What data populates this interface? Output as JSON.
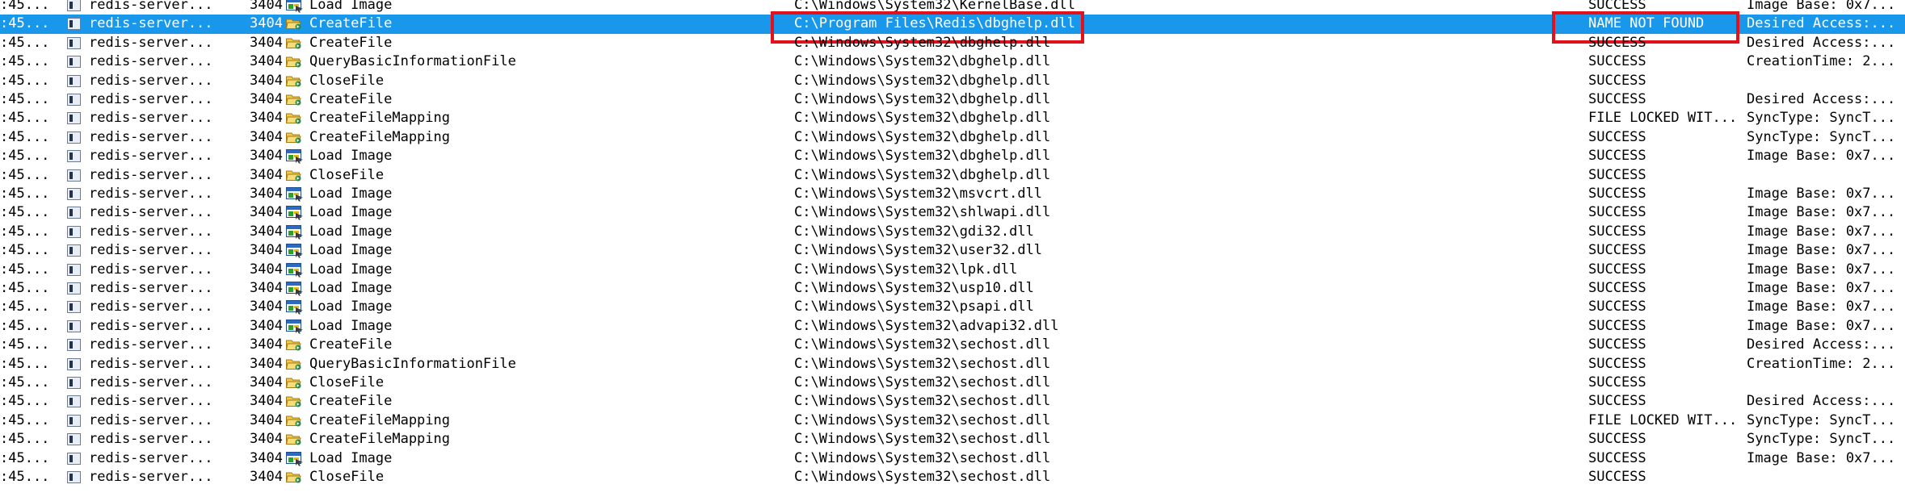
{
  "colors": {
    "selection": "#1997ea",
    "annotation": "#e3111b"
  },
  "rows": [
    {
      "time": ":45...",
      "process": "redis-server...",
      "pid": "3404",
      "op_icon": "load-image-icon",
      "operation": "Load Image",
      "path": "C:\\Windows\\System32\\KernelBase.dll",
      "result": "SUCCESS",
      "detail": "Image Base: 0x7..."
    },
    {
      "time": ":45...",
      "process": "redis-server...",
      "pid": "3404",
      "op_icon": "file-system-icon",
      "operation": "CreateFile",
      "path": "C:\\Program Files\\Redis\\dbghelp.dll",
      "result": "NAME NOT FOUND",
      "detail": "Desired Access:...",
      "selected": true
    },
    {
      "time": ":45...",
      "process": "redis-server...",
      "pid": "3404",
      "op_icon": "file-system-icon",
      "operation": "CreateFile",
      "path": "C:\\Windows\\System32\\dbghelp.dll",
      "result": "SUCCESS",
      "detail": "Desired Access:..."
    },
    {
      "time": ":45...",
      "process": "redis-server...",
      "pid": "3404",
      "op_icon": "file-system-icon",
      "operation": "QueryBasicInformationFile",
      "path": "C:\\Windows\\System32\\dbghelp.dll",
      "result": "SUCCESS",
      "detail": "CreationTime: 2..."
    },
    {
      "time": ":45...",
      "process": "redis-server...",
      "pid": "3404",
      "op_icon": "file-system-icon",
      "operation": "CloseFile",
      "path": "C:\\Windows\\System32\\dbghelp.dll",
      "result": "SUCCESS",
      "detail": ""
    },
    {
      "time": ":45...",
      "process": "redis-server...",
      "pid": "3404",
      "op_icon": "file-system-icon",
      "operation": "CreateFile",
      "path": "C:\\Windows\\System32\\dbghelp.dll",
      "result": "SUCCESS",
      "detail": "Desired Access:..."
    },
    {
      "time": ":45...",
      "process": "redis-server...",
      "pid": "3404",
      "op_icon": "file-system-icon",
      "operation": "CreateFileMapping",
      "path": "C:\\Windows\\System32\\dbghelp.dll",
      "result": "FILE LOCKED WIT...",
      "detail": "SyncType: SyncT..."
    },
    {
      "time": ":45...",
      "process": "redis-server...",
      "pid": "3404",
      "op_icon": "file-system-icon",
      "operation": "CreateFileMapping",
      "path": "C:\\Windows\\System32\\dbghelp.dll",
      "result": "SUCCESS",
      "detail": "SyncType: SyncT..."
    },
    {
      "time": ":45...",
      "process": "redis-server...",
      "pid": "3404",
      "op_icon": "load-image-icon",
      "operation": "Load Image",
      "path": "C:\\Windows\\System32\\dbghelp.dll",
      "result": "SUCCESS",
      "detail": "Image Base: 0x7..."
    },
    {
      "time": ":45...",
      "process": "redis-server...",
      "pid": "3404",
      "op_icon": "file-system-icon",
      "operation": "CloseFile",
      "path": "C:\\Windows\\System32\\dbghelp.dll",
      "result": "SUCCESS",
      "detail": ""
    },
    {
      "time": ":45...",
      "process": "redis-server...",
      "pid": "3404",
      "op_icon": "load-image-icon",
      "operation": "Load Image",
      "path": "C:\\Windows\\System32\\msvcrt.dll",
      "result": "SUCCESS",
      "detail": "Image Base: 0x7..."
    },
    {
      "time": ":45...",
      "process": "redis-server...",
      "pid": "3404",
      "op_icon": "load-image-icon",
      "operation": "Load Image",
      "path": "C:\\Windows\\System32\\shlwapi.dll",
      "result": "SUCCESS",
      "detail": "Image Base: 0x7..."
    },
    {
      "time": ":45...",
      "process": "redis-server...",
      "pid": "3404",
      "op_icon": "load-image-icon",
      "operation": "Load Image",
      "path": "C:\\Windows\\System32\\gdi32.dll",
      "result": "SUCCESS",
      "detail": "Image Base: 0x7..."
    },
    {
      "time": ":45...",
      "process": "redis-server...",
      "pid": "3404",
      "op_icon": "load-image-icon",
      "operation": "Load Image",
      "path": "C:\\Windows\\System32\\user32.dll",
      "result": "SUCCESS",
      "detail": "Image Base: 0x7..."
    },
    {
      "time": ":45...",
      "process": "redis-server...",
      "pid": "3404",
      "op_icon": "load-image-icon",
      "operation": "Load Image",
      "path": "C:\\Windows\\System32\\lpk.dll",
      "result": "SUCCESS",
      "detail": "Image Base: 0x7..."
    },
    {
      "time": ":45...",
      "process": "redis-server...",
      "pid": "3404",
      "op_icon": "load-image-icon",
      "operation": "Load Image",
      "path": "C:\\Windows\\System32\\usp10.dll",
      "result": "SUCCESS",
      "detail": "Image Base: 0x7..."
    },
    {
      "time": ":45...",
      "process": "redis-server...",
      "pid": "3404",
      "op_icon": "load-image-icon",
      "operation": "Load Image",
      "path": "C:\\Windows\\System32\\psapi.dll",
      "result": "SUCCESS",
      "detail": "Image Base: 0x7..."
    },
    {
      "time": ":45...",
      "process": "redis-server...",
      "pid": "3404",
      "op_icon": "load-image-icon",
      "operation": "Load Image",
      "path": "C:\\Windows\\System32\\advapi32.dll",
      "result": "SUCCESS",
      "detail": "Image Base: 0x7..."
    },
    {
      "time": ":45...",
      "process": "redis-server...",
      "pid": "3404",
      "op_icon": "file-system-icon",
      "operation": "CreateFile",
      "path": "C:\\Windows\\System32\\sechost.dll",
      "result": "SUCCESS",
      "detail": "Desired Access:..."
    },
    {
      "time": ":45...",
      "process": "redis-server...",
      "pid": "3404",
      "op_icon": "file-system-icon",
      "operation": "QueryBasicInformationFile",
      "path": "C:\\Windows\\System32\\sechost.dll",
      "result": "SUCCESS",
      "detail": "CreationTime: 2..."
    },
    {
      "time": ":45...",
      "process": "redis-server...",
      "pid": "3404",
      "op_icon": "file-system-icon",
      "operation": "CloseFile",
      "path": "C:\\Windows\\System32\\sechost.dll",
      "result": "SUCCESS",
      "detail": ""
    },
    {
      "time": ":45...",
      "process": "redis-server...",
      "pid": "3404",
      "op_icon": "file-system-icon",
      "operation": "CreateFile",
      "path": "C:\\Windows\\System32\\sechost.dll",
      "result": "SUCCESS",
      "detail": "Desired Access:..."
    },
    {
      "time": ":45...",
      "process": "redis-server...",
      "pid": "3404",
      "op_icon": "file-system-icon",
      "operation": "CreateFileMapping",
      "path": "C:\\Windows\\System32\\sechost.dll",
      "result": "FILE LOCKED WIT...",
      "detail": "SyncType: SyncT..."
    },
    {
      "time": ":45...",
      "process": "redis-server...",
      "pid": "3404",
      "op_icon": "file-system-icon",
      "operation": "CreateFileMapping",
      "path": "C:\\Windows\\System32\\sechost.dll",
      "result": "SUCCESS",
      "detail": "SyncType: SyncT..."
    },
    {
      "time": ":45...",
      "process": "redis-server...",
      "pid": "3404",
      "op_icon": "load-image-icon",
      "operation": "Load Image",
      "path": "C:\\Windows\\System32\\sechost.dll",
      "result": "SUCCESS",
      "detail": "Image Base: 0x7..."
    },
    {
      "time": ":45...",
      "process": "redis-server...",
      "pid": "3404",
      "op_icon": "file-system-icon",
      "operation": "CloseFile",
      "path": "C:\\Windows\\System32\\sechost.dll",
      "result": "SUCCESS",
      "detail": ""
    }
  ]
}
